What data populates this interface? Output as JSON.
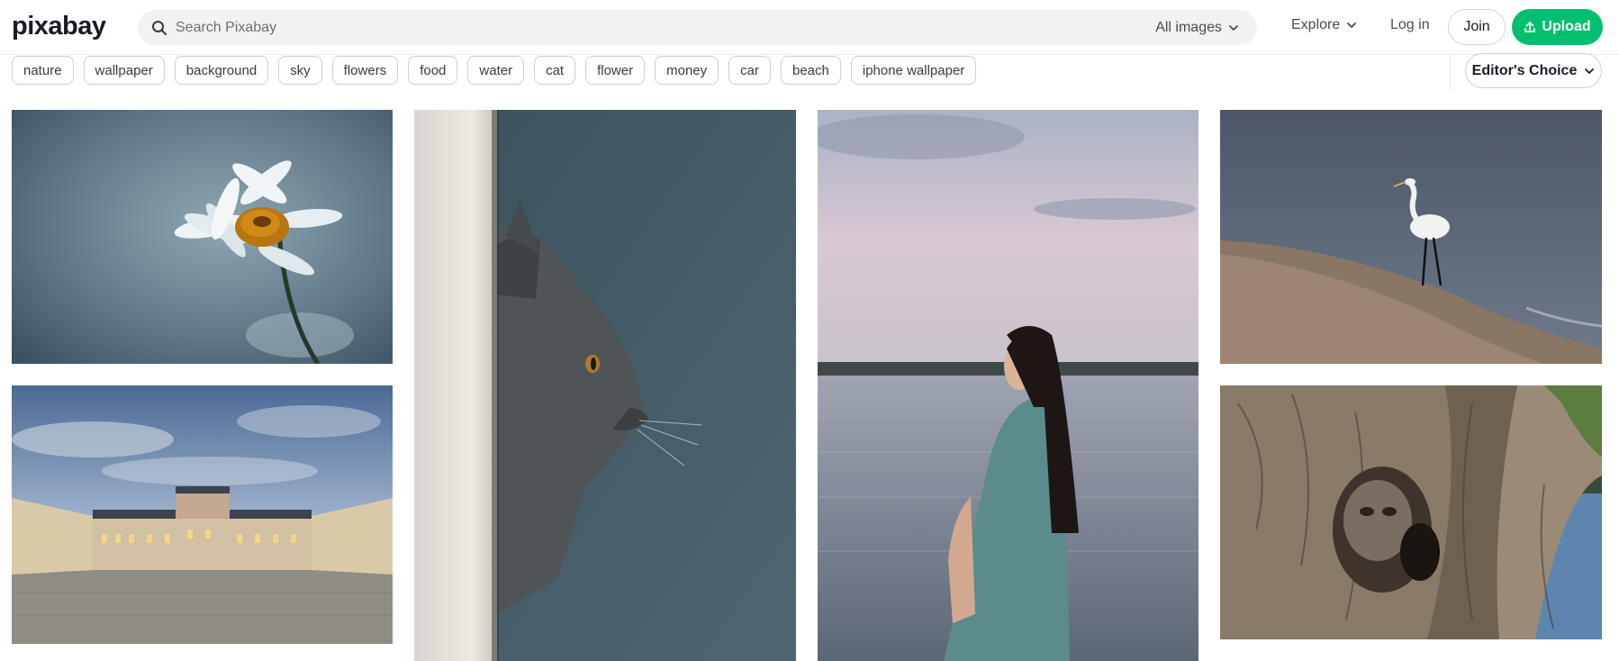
{
  "header": {
    "logo_text": "pixabay",
    "search": {
      "placeholder": "Search Pixabay",
      "value": "",
      "filter": "All images"
    },
    "nav": {
      "explore": "Explore",
      "login": "Log in",
      "join": "Join",
      "upload": "Upload"
    }
  },
  "tags": [
    "nature",
    "wallpaper",
    "background",
    "sky",
    "flowers",
    "food",
    "water",
    "cat",
    "flower",
    "money",
    "car",
    "beach",
    "iphone wallpaper"
  ],
  "sort": {
    "label": "Editor's Choice"
  },
  "colors": {
    "brand_green": "#02bf6f",
    "text": "#191b26",
    "muted": "#6d6e75"
  },
  "photos": [
    {
      "subject": "white daisy flower on blue background"
    },
    {
      "subject": "grey kitten peeking behind a wall"
    },
    {
      "subject": "woman by a lake at dusk"
    },
    {
      "subject": "white egret on a beach"
    },
    {
      "subject": "baroque palace under a cloudy sky"
    },
    {
      "subject": "owl hidden in a tree hollow"
    }
  ]
}
